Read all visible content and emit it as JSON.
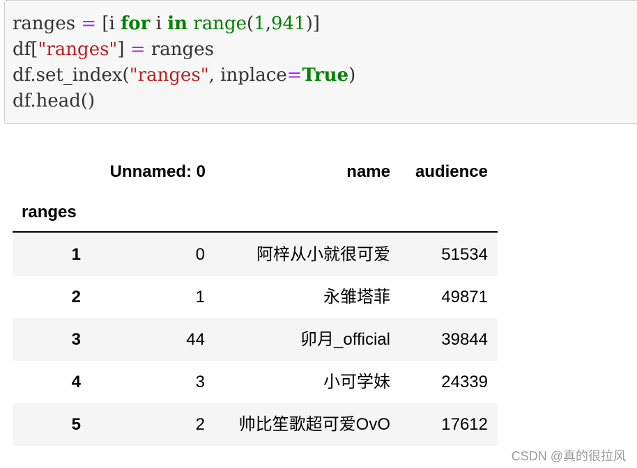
{
  "code": {
    "line1": {
      "a": "ranges",
      "b": " = ",
      "c": "[i ",
      "d": "for",
      "e": " i ",
      "f": "in",
      "g": " ",
      "h": "range",
      "i": "(",
      "j": "1",
      "k": ",",
      "l": "941",
      "m": ")]"
    },
    "line2": {
      "a": "df[",
      "b": "\"ranges\"",
      "c": "] ",
      "d": "=",
      "e": " ranges"
    },
    "line3": {
      "a": "df.set_index(",
      "b": "\"ranges\"",
      "c": ", inplace",
      "d": "=",
      "e": "True",
      "f": ")"
    },
    "line4": {
      "a": "df.head()"
    }
  },
  "table": {
    "columns": [
      "Unnamed: 0",
      "name",
      "audience"
    ],
    "index_name": "ranges",
    "rows": [
      {
        "index": "1",
        "unnamed": "0",
        "name": "阿梓从小就很可爱",
        "audience": "51534"
      },
      {
        "index": "2",
        "unnamed": "1",
        "name": "永雏塔菲",
        "audience": "49871"
      },
      {
        "index": "3",
        "unnamed": "44",
        "name": "卯月_official",
        "audience": "39844"
      },
      {
        "index": "4",
        "unnamed": "3",
        "name": "小可学妹",
        "audience": "24339"
      },
      {
        "index": "5",
        "unnamed": "2",
        "name": "帅比笙歌超可爱OvO",
        "audience": "17612"
      }
    ]
  },
  "watermark": "CSDN @真的很拉风"
}
